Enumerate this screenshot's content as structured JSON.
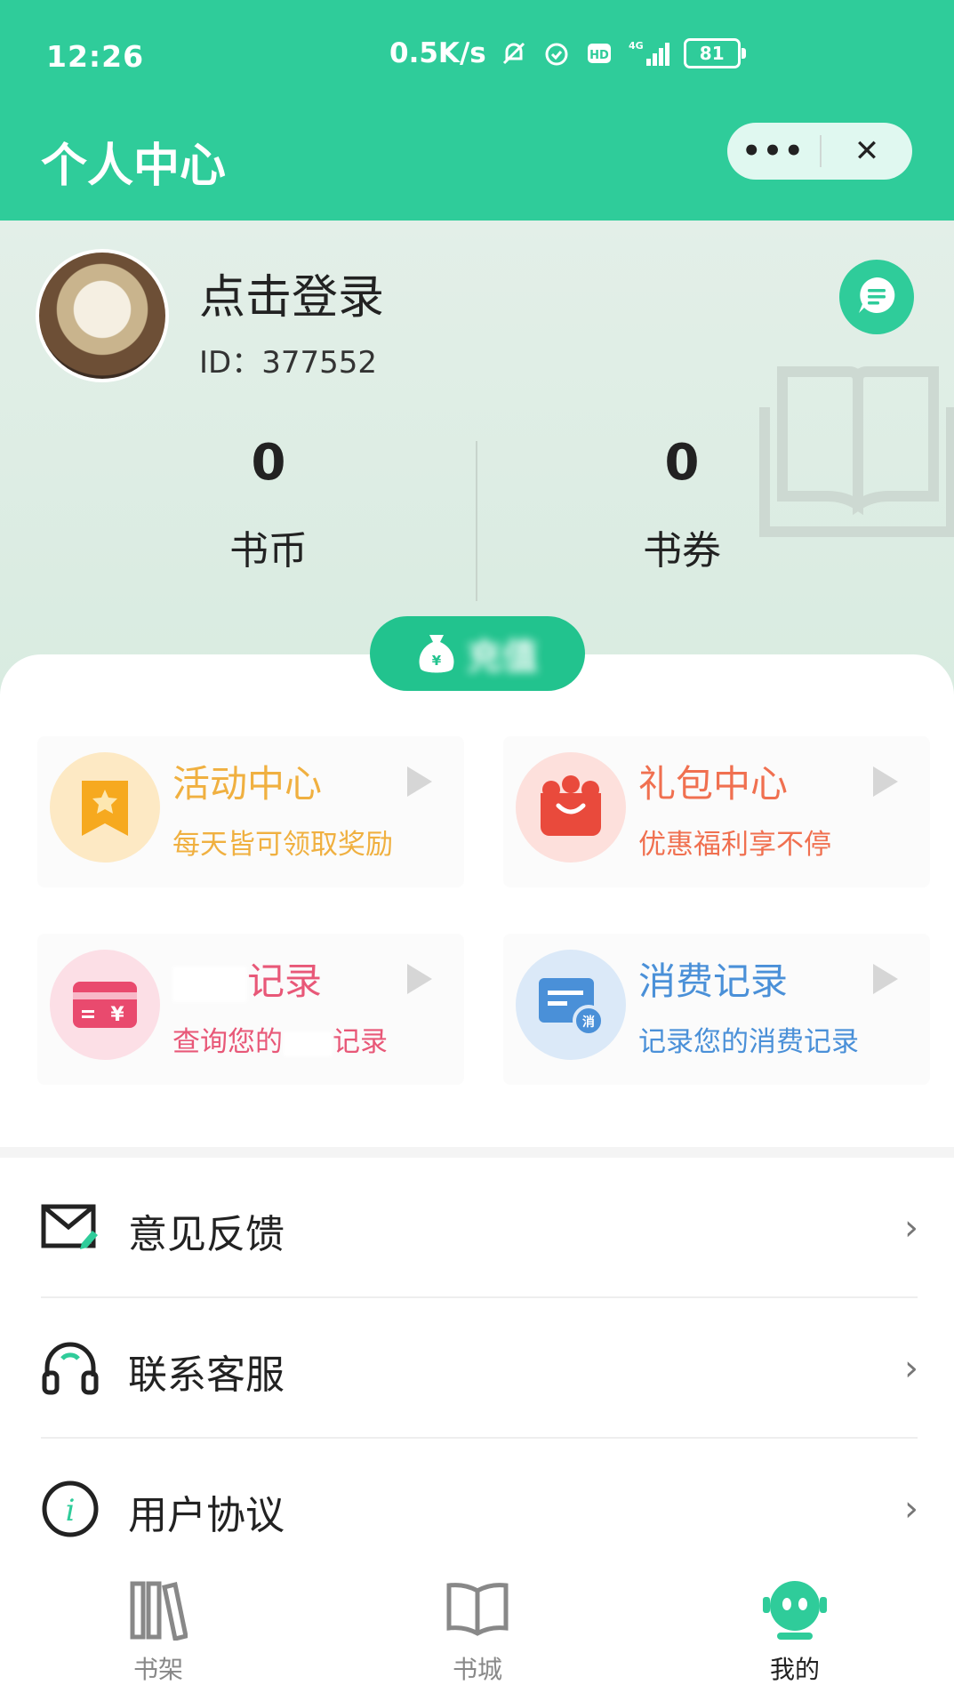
{
  "status_bar": {
    "time": "12:26",
    "speed": "0.5K/s",
    "network": "4G",
    "battery": "81"
  },
  "header": {
    "title": "个人中心",
    "more_label": "•••",
    "close_label": "✕"
  },
  "profile": {
    "login_text": "点击登录",
    "user_id": "ID：377552"
  },
  "stats": [
    {
      "value": "0",
      "label": "书币"
    },
    {
      "value": "0",
      "label": "书券"
    }
  ],
  "recharge_label": "充值",
  "cards": [
    {
      "title": "活动中心",
      "subtitle": "每天皆可领取奖励",
      "color": "#f0b040",
      "icon": "star-bookmark-icon"
    },
    {
      "title": "礼包中心",
      "subtitle": "优惠福利享不停",
      "color": "#f07050",
      "icon": "gift-basket-icon"
    },
    {
      "title": "记录",
      "subtitle_prefix": "查询您的",
      "subtitle_suffix": "记录",
      "color": "#e85878",
      "icon": "recharge-card-icon"
    },
    {
      "title": "消费记录",
      "subtitle": "记录您的消费记录",
      "color": "#4a90d8",
      "icon": "consume-record-icon"
    }
  ],
  "menu": [
    {
      "label": "意见反馈",
      "icon": "mail-feedback-icon"
    },
    {
      "label": "联系客服",
      "icon": "headset-icon"
    },
    {
      "label": "用户协议",
      "icon": "info-icon"
    }
  ],
  "tabs": [
    {
      "label": "书架",
      "icon": "bookshelf-icon"
    },
    {
      "label": "书城",
      "icon": "open-book-icon"
    },
    {
      "label": "我的",
      "icon": "robot-face-icon",
      "active": true
    }
  ],
  "colors": {
    "brand": "#2fcc9a",
    "profile_bg": "#e3efe8"
  }
}
